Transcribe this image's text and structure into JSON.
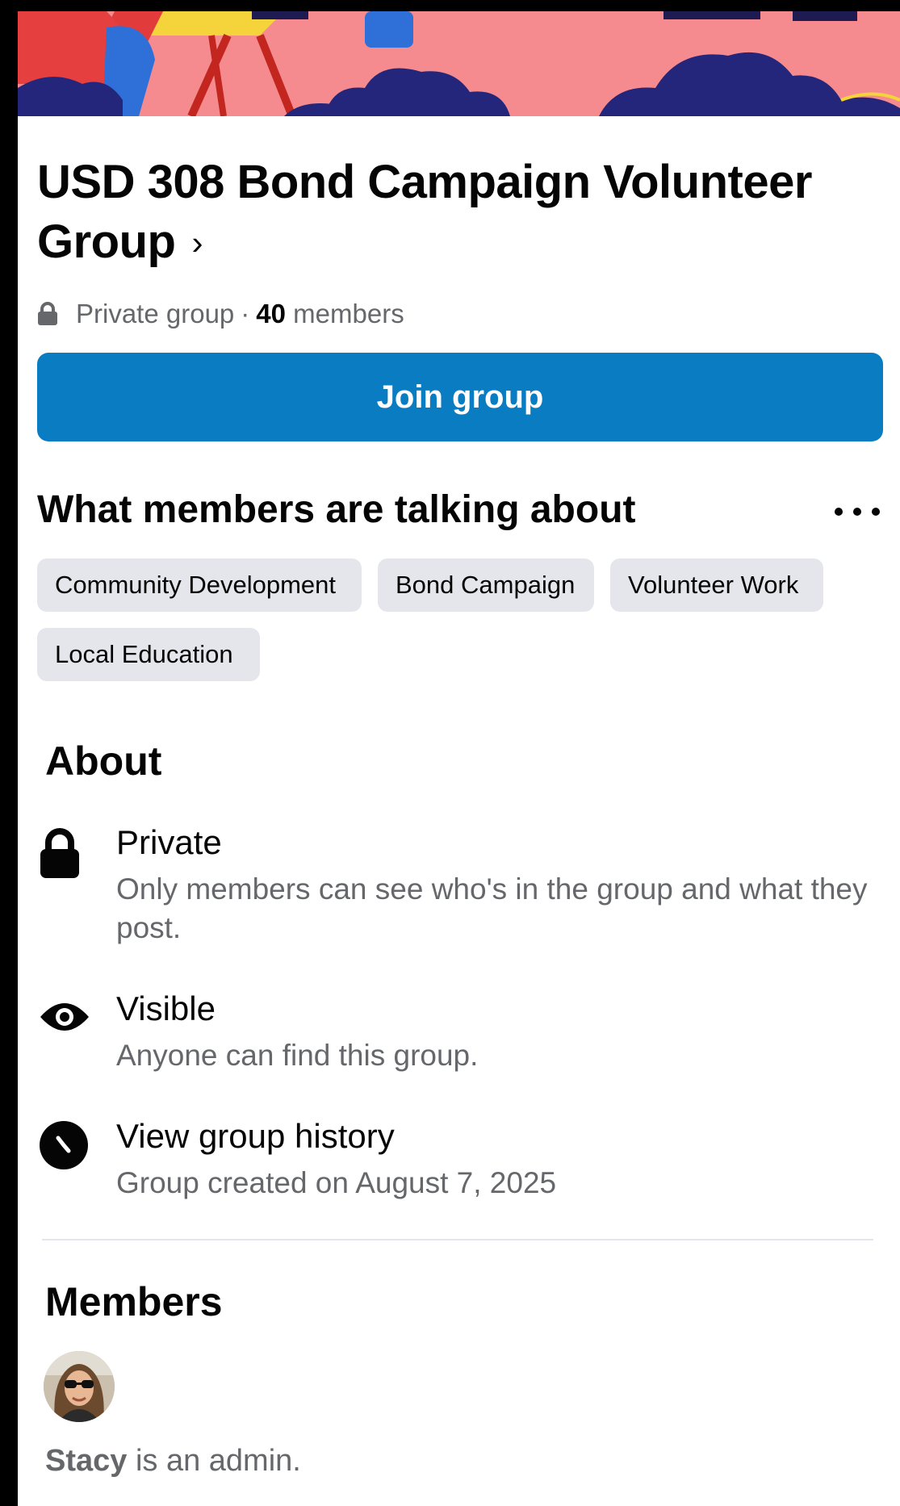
{
  "group": {
    "title": "USD 308 Bond Campaign Volunteer Group",
    "chevron": "›",
    "privacy": "Private group",
    "separator": "·",
    "member_count": "40",
    "member_word": "members"
  },
  "join_button": {
    "label": "Join group",
    "color": "#0a7cc1"
  },
  "topics": {
    "heading": "What members are talking about",
    "chips": [
      "Community Development",
      "Bond Campaign",
      "Volunteer Work",
      "Local Education"
    ]
  },
  "about": {
    "heading": "About",
    "items": [
      {
        "icon": "lock-icon",
        "title": "Private",
        "description": "Only members can see who's in the group and what they post."
      },
      {
        "icon": "eye-icon",
        "title": "Visible",
        "description": "Anyone can find this group."
      },
      {
        "icon": "clock-icon",
        "title": "View group history",
        "description": "Group created on August 7, 2025"
      }
    ]
  },
  "members": {
    "heading": "Members",
    "admin_name": "Stacy",
    "admin_suffix": " is an admin."
  }
}
